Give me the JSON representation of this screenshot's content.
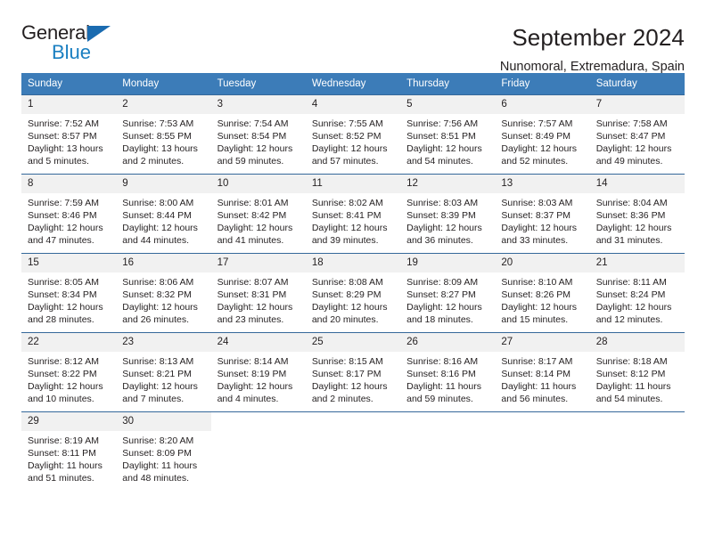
{
  "logo": {
    "word_top": "General",
    "word_bottom": "Blue",
    "triangle_icon": "triangle-icon",
    "accent_color": "#1a7fc1"
  },
  "header": {
    "title": "September 2024",
    "subtitle": "Nunomoral, Extremadura, Spain"
  },
  "calendar": {
    "header_bg": "#3c7cb8",
    "daynum_bg": "#f1f1f1",
    "row_border": "#35689a",
    "weekday_headers": [
      "Sunday",
      "Monday",
      "Tuesday",
      "Wednesday",
      "Thursday",
      "Friday",
      "Saturday"
    ],
    "weeks": [
      [
        {
          "day": "1",
          "sunrise": "Sunrise: 7:52 AM",
          "sunset": "Sunset: 8:57 PM",
          "daylight_line1": "Daylight: 13 hours",
          "daylight_line2": "and 5 minutes."
        },
        {
          "day": "2",
          "sunrise": "Sunrise: 7:53 AM",
          "sunset": "Sunset: 8:55 PM",
          "daylight_line1": "Daylight: 13 hours",
          "daylight_line2": "and 2 minutes."
        },
        {
          "day": "3",
          "sunrise": "Sunrise: 7:54 AM",
          "sunset": "Sunset: 8:54 PM",
          "daylight_line1": "Daylight: 12 hours",
          "daylight_line2": "and 59 minutes."
        },
        {
          "day": "4",
          "sunrise": "Sunrise: 7:55 AM",
          "sunset": "Sunset: 8:52 PM",
          "daylight_line1": "Daylight: 12 hours",
          "daylight_line2": "and 57 minutes."
        },
        {
          "day": "5",
          "sunrise": "Sunrise: 7:56 AM",
          "sunset": "Sunset: 8:51 PM",
          "daylight_line1": "Daylight: 12 hours",
          "daylight_line2": "and 54 minutes."
        },
        {
          "day": "6",
          "sunrise": "Sunrise: 7:57 AM",
          "sunset": "Sunset: 8:49 PM",
          "daylight_line1": "Daylight: 12 hours",
          "daylight_line2": "and 52 minutes."
        },
        {
          "day": "7",
          "sunrise": "Sunrise: 7:58 AM",
          "sunset": "Sunset: 8:47 PM",
          "daylight_line1": "Daylight: 12 hours",
          "daylight_line2": "and 49 minutes."
        }
      ],
      [
        {
          "day": "8",
          "sunrise": "Sunrise: 7:59 AM",
          "sunset": "Sunset: 8:46 PM",
          "daylight_line1": "Daylight: 12 hours",
          "daylight_line2": "and 47 minutes."
        },
        {
          "day": "9",
          "sunrise": "Sunrise: 8:00 AM",
          "sunset": "Sunset: 8:44 PM",
          "daylight_line1": "Daylight: 12 hours",
          "daylight_line2": "and 44 minutes."
        },
        {
          "day": "10",
          "sunrise": "Sunrise: 8:01 AM",
          "sunset": "Sunset: 8:42 PM",
          "daylight_line1": "Daylight: 12 hours",
          "daylight_line2": "and 41 minutes."
        },
        {
          "day": "11",
          "sunrise": "Sunrise: 8:02 AM",
          "sunset": "Sunset: 8:41 PM",
          "daylight_line1": "Daylight: 12 hours",
          "daylight_line2": "and 39 minutes."
        },
        {
          "day": "12",
          "sunrise": "Sunrise: 8:03 AM",
          "sunset": "Sunset: 8:39 PM",
          "daylight_line1": "Daylight: 12 hours",
          "daylight_line2": "and 36 minutes."
        },
        {
          "day": "13",
          "sunrise": "Sunrise: 8:03 AM",
          "sunset": "Sunset: 8:37 PM",
          "daylight_line1": "Daylight: 12 hours",
          "daylight_line2": "and 33 minutes."
        },
        {
          "day": "14",
          "sunrise": "Sunrise: 8:04 AM",
          "sunset": "Sunset: 8:36 PM",
          "daylight_line1": "Daylight: 12 hours",
          "daylight_line2": "and 31 minutes."
        }
      ],
      [
        {
          "day": "15",
          "sunrise": "Sunrise: 8:05 AM",
          "sunset": "Sunset: 8:34 PM",
          "daylight_line1": "Daylight: 12 hours",
          "daylight_line2": "and 28 minutes."
        },
        {
          "day": "16",
          "sunrise": "Sunrise: 8:06 AM",
          "sunset": "Sunset: 8:32 PM",
          "daylight_line1": "Daylight: 12 hours",
          "daylight_line2": "and 26 minutes."
        },
        {
          "day": "17",
          "sunrise": "Sunrise: 8:07 AM",
          "sunset": "Sunset: 8:31 PM",
          "daylight_line1": "Daylight: 12 hours",
          "daylight_line2": "and 23 minutes."
        },
        {
          "day": "18",
          "sunrise": "Sunrise: 8:08 AM",
          "sunset": "Sunset: 8:29 PM",
          "daylight_line1": "Daylight: 12 hours",
          "daylight_line2": "and 20 minutes."
        },
        {
          "day": "19",
          "sunrise": "Sunrise: 8:09 AM",
          "sunset": "Sunset: 8:27 PM",
          "daylight_line1": "Daylight: 12 hours",
          "daylight_line2": "and 18 minutes."
        },
        {
          "day": "20",
          "sunrise": "Sunrise: 8:10 AM",
          "sunset": "Sunset: 8:26 PM",
          "daylight_line1": "Daylight: 12 hours",
          "daylight_line2": "and 15 minutes."
        },
        {
          "day": "21",
          "sunrise": "Sunrise: 8:11 AM",
          "sunset": "Sunset: 8:24 PM",
          "daylight_line1": "Daylight: 12 hours",
          "daylight_line2": "and 12 minutes."
        }
      ],
      [
        {
          "day": "22",
          "sunrise": "Sunrise: 8:12 AM",
          "sunset": "Sunset: 8:22 PM",
          "daylight_line1": "Daylight: 12 hours",
          "daylight_line2": "and 10 minutes."
        },
        {
          "day": "23",
          "sunrise": "Sunrise: 8:13 AM",
          "sunset": "Sunset: 8:21 PM",
          "daylight_line1": "Daylight: 12 hours",
          "daylight_line2": "and 7 minutes."
        },
        {
          "day": "24",
          "sunrise": "Sunrise: 8:14 AM",
          "sunset": "Sunset: 8:19 PM",
          "daylight_line1": "Daylight: 12 hours",
          "daylight_line2": "and 4 minutes."
        },
        {
          "day": "25",
          "sunrise": "Sunrise: 8:15 AM",
          "sunset": "Sunset: 8:17 PM",
          "daylight_line1": "Daylight: 12 hours",
          "daylight_line2": "and 2 minutes."
        },
        {
          "day": "26",
          "sunrise": "Sunrise: 8:16 AM",
          "sunset": "Sunset: 8:16 PM",
          "daylight_line1": "Daylight: 11 hours",
          "daylight_line2": "and 59 minutes."
        },
        {
          "day": "27",
          "sunrise": "Sunrise: 8:17 AM",
          "sunset": "Sunset: 8:14 PM",
          "daylight_line1": "Daylight: 11 hours",
          "daylight_line2": "and 56 minutes."
        },
        {
          "day": "28",
          "sunrise": "Sunrise: 8:18 AM",
          "sunset": "Sunset: 8:12 PM",
          "daylight_line1": "Daylight: 11 hours",
          "daylight_line2": "and 54 minutes."
        }
      ],
      [
        {
          "day": "29",
          "sunrise": "Sunrise: 8:19 AM",
          "sunset": "Sunset: 8:11 PM",
          "daylight_line1": "Daylight: 11 hours",
          "daylight_line2": "and 51 minutes."
        },
        {
          "day": "30",
          "sunrise": "Sunrise: 8:20 AM",
          "sunset": "Sunset: 8:09 PM",
          "daylight_line1": "Daylight: 11 hours",
          "daylight_line2": "and 48 minutes."
        },
        {
          "day": "",
          "sunrise": "",
          "sunset": "",
          "daylight_line1": "",
          "daylight_line2": ""
        },
        {
          "day": "",
          "sunrise": "",
          "sunset": "",
          "daylight_line1": "",
          "daylight_line2": ""
        },
        {
          "day": "",
          "sunrise": "",
          "sunset": "",
          "daylight_line1": "",
          "daylight_line2": ""
        },
        {
          "day": "",
          "sunrise": "",
          "sunset": "",
          "daylight_line1": "",
          "daylight_line2": ""
        },
        {
          "day": "",
          "sunrise": "",
          "sunset": "",
          "daylight_line1": "",
          "daylight_line2": ""
        }
      ]
    ]
  }
}
